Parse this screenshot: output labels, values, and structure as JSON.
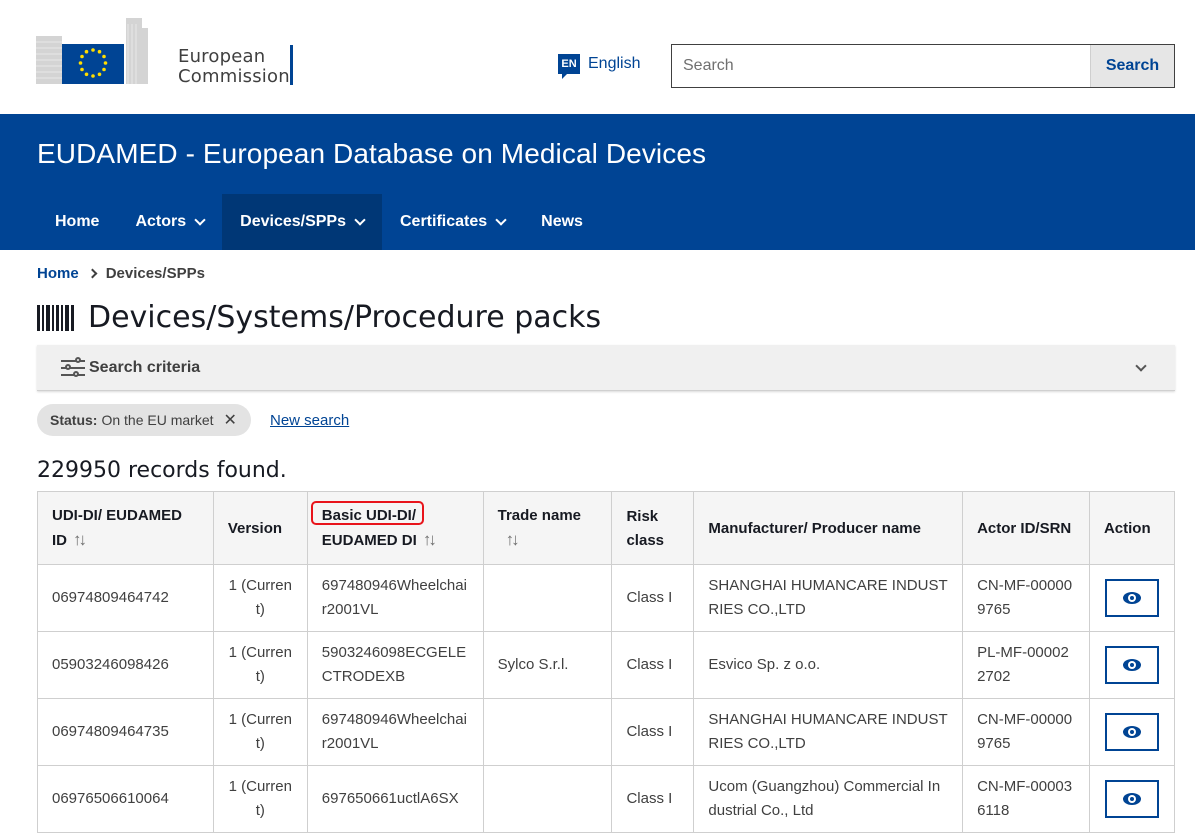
{
  "header": {
    "org_line1": "European",
    "org_line2": "Commission",
    "lang_code": "EN",
    "lang_label": "English",
    "search_placeholder": "Search",
    "search_button": "Search"
  },
  "banner": {
    "site_title": "EUDAMED - European Database on Medical Devices"
  },
  "nav": {
    "items": [
      {
        "label": "Home"
      },
      {
        "label": "Actors"
      },
      {
        "label": "Devices/SPPs"
      },
      {
        "label": "Certificates"
      },
      {
        "label": "News"
      }
    ]
  },
  "breadcrumb": {
    "home": "Home",
    "current": "Devices/SPPs"
  },
  "page": {
    "title": "Devices/Systems/Procedure packs",
    "criteria_label": "Search criteria",
    "filter_key": "Status:",
    "filter_value": "On the EU market",
    "filter_remove": "✕",
    "new_search": "New search",
    "records_found": "229950 records found."
  },
  "table": {
    "headers": {
      "udi": "UDI-DI/ EUDAMED ID",
      "version": "Version",
      "basic": "Basic UDI-DI/ EUDAMED DI",
      "trade": "Trade name",
      "risk": "Risk class",
      "manufacturer": "Manufacturer/ Producer name",
      "actor": "Actor ID/SRN",
      "action": "Action"
    },
    "rows": [
      {
        "udi": "06974809464742",
        "version": "1 (Current)",
        "basic": "697480946Wheelchair2001VL",
        "trade": "",
        "risk": "Class I",
        "manufacturer": "SHANGHAI HUMANCARE INDUSTRIES CO.,LTD",
        "actor": "CN-MF-000009765"
      },
      {
        "udi": "05903246098426",
        "version": "1 (Current)",
        "basic": "5903246098ECGELECTRODEXB",
        "trade": "Sylco S.r.l.",
        "risk": "Class I",
        "manufacturer": "Esvico Sp. z o.o.",
        "actor": "PL-MF-000022702"
      },
      {
        "udi": "06974809464735",
        "version": "1 (Current)",
        "basic": "697480946Wheelchair2001VL",
        "trade": "",
        "risk": "Class I",
        "manufacturer": "SHANGHAI HUMANCARE INDUSTRIES CO.,LTD",
        "actor": "CN-MF-000009765"
      },
      {
        "udi": "06976506610064",
        "version": "1 (Current)",
        "basic": "697650661uctlA6SX",
        "trade": "",
        "risk": "Class I",
        "manufacturer": "Ucom (Guangzhou) Commercial Industrial Co., Ltd",
        "actor": "CN-MF-000036118"
      }
    ]
  },
  "colors": {
    "brand_blue": "#004494",
    "nav_active": "#003776",
    "highlight": "#e8141b"
  }
}
